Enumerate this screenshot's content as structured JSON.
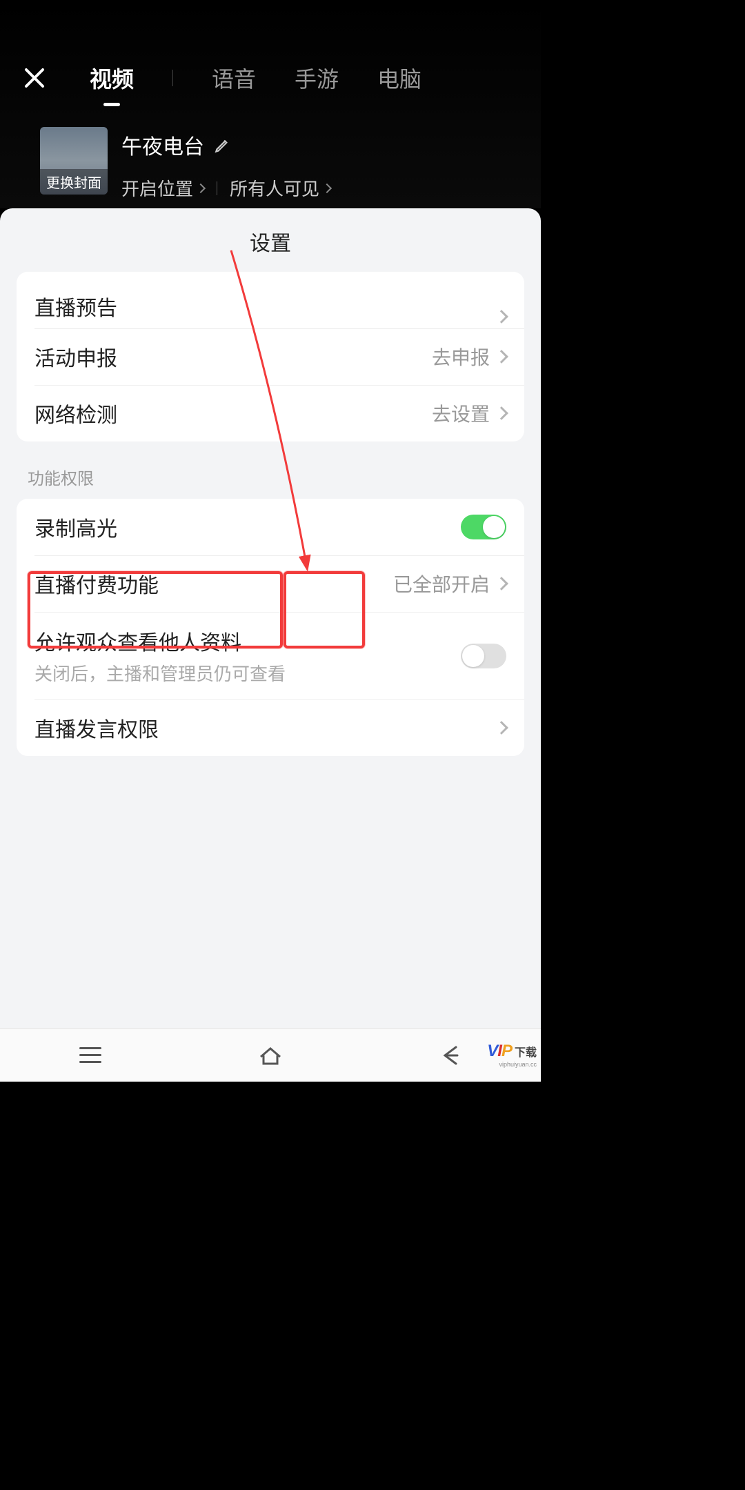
{
  "header": {
    "tabs": [
      "视频",
      "语音",
      "手游",
      "电脑"
    ],
    "active_tab_index": 0
  },
  "stream": {
    "cover_label": "更换封面",
    "title": "午夜电台",
    "location_label": "开启位置",
    "visibility_label": "所有人可见"
  },
  "sheet": {
    "title": "设置",
    "group1": {
      "row_partial": "直播预告",
      "row_activity": {
        "label": "活动申报",
        "value": "去申报"
      },
      "row_network": {
        "label": "网络检测",
        "value": "去设置"
      }
    },
    "section_permissions": "功能权限",
    "group2": {
      "row_highlight": {
        "label": "录制高光",
        "on": true
      },
      "row_paid": {
        "label": "直播付费功能",
        "value": "已全部开启"
      },
      "row_viewprofile": {
        "label": "允许观众查看他人资料",
        "sub": "关闭后，主播和管理员仍可查看",
        "on": false
      },
      "row_speak": {
        "label": "直播发言权限"
      }
    }
  },
  "watermark": {
    "text": "下载",
    "url": "viphuiyuan.cc"
  }
}
